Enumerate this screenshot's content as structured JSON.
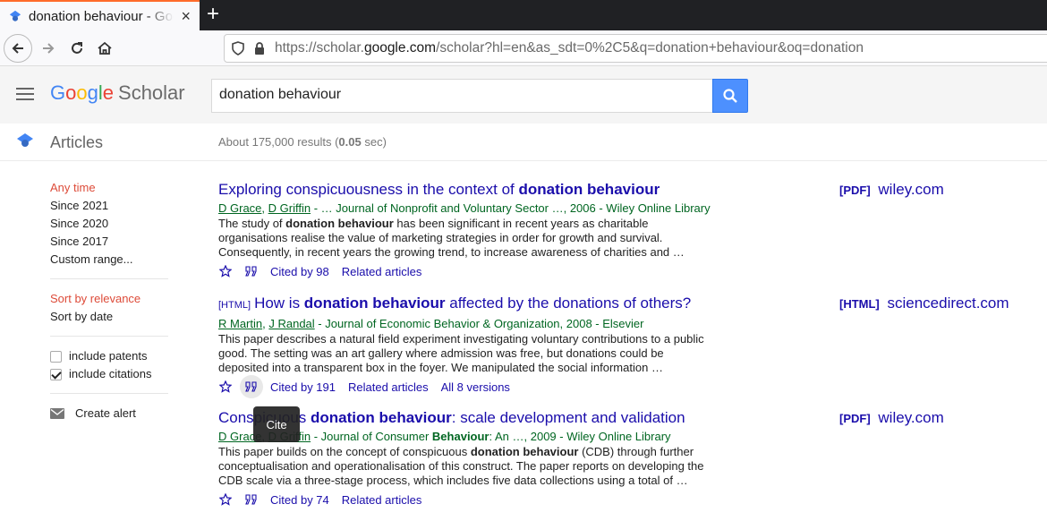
{
  "browser": {
    "tab_title": "donation behaviour - Google Scholar",
    "tab_close": "×",
    "new_tab": "+",
    "url_prefix": "https://scholar.",
    "url_domain": "google.com",
    "url_suffix": "/scholar?hl=en&as_sdt=0%2C5&q=donation+behaviour&oq=donation"
  },
  "logo": {
    "google": [
      "G",
      "o",
      "o",
      "g",
      "l",
      "e"
    ],
    "google_colors": [
      "#4285f4",
      "#ea4335",
      "#fbbc05",
      "#4285f4",
      "#34a853",
      "#ea4335"
    ],
    "scholar": "Scholar"
  },
  "search": {
    "value": "donation behaviour"
  },
  "subbar": {
    "section": "Articles",
    "results_prefix": "About 175,000 results (",
    "results_time": "0.05",
    "results_suffix": " sec)"
  },
  "sidebar": {
    "time": [
      "Any time",
      "Since 2021",
      "Since 2020",
      "Since 2017",
      "Custom range..."
    ],
    "sort": [
      "Sort by relevance",
      "Sort by date"
    ],
    "include_patents": "include patents",
    "include_citations": "include citations",
    "create_alert": "Create alert"
  },
  "results": [
    {
      "title_pre": "Exploring conspicuousness in the context of ",
      "title_bold": "donation behaviour",
      "title_post": "",
      "authors": [
        "D Grace",
        "D Griffin"
      ],
      "authors_sep": ", ",
      "source": " - … Journal of Nonprofit and Voluntary Sector …, 2006 - Wiley Online Library",
      "snippet_parts": [
        "The study of ",
        "donation behaviour",
        " has been significant in recent years as charitable organisations realise the value of marketing strategies in order for growth and survival. Consequently, in recent years the growing trend, to increase awareness of charities and …"
      ],
      "cited_by": "Cited by 98",
      "related": "Related articles",
      "side_tag": "[PDF]",
      "side_domain": "wiley.com"
    },
    {
      "tag": "[HTML]",
      "title_pre": "How is ",
      "title_bold": "donation behaviour",
      "title_post": " affected by the donations of others?",
      "authors": [
        "R Martin",
        "J Randal"
      ],
      "authors_sep": ", ",
      "source": " - Journal of Economic Behavior & Organization, 2008 - Elsevier",
      "snippet": "This paper describes a natural field experiment investigating voluntary contributions to a public good. The setting was an art gallery where admission was free, but donations could be deposited into a transparent box in the foyer. We manipulated the social information …",
      "cited_by": "Cited by 191",
      "related": "Related articles",
      "versions": "All 8 versions",
      "side_tag": "[HTML]",
      "side_domain": "sciencedirect.com"
    },
    {
      "title_pre": "Conspicuous ",
      "title_bold": "donation behaviour",
      "title_post": ": scale development and validation",
      "authors": [
        "D Grace",
        "D Griffin"
      ],
      "authors_sep": ", ",
      "source_pre": " - Journal of Consumer ",
      "source_bold": "Behaviour",
      "source_post": ": An …, 2009 - Wiley Online Library",
      "snippet_parts": [
        "This paper builds on the concept of conspicuous ",
        "donation behaviour",
        " (CDB) through further conceptualisation and operationalisation of this construct. The paper reports on developing the CDB scale via a three-stage process, which includes five data collections using a total of …"
      ],
      "cited_by": "Cited by 74",
      "related": "Related articles",
      "side_tag": "[PDF]",
      "side_domain": "wiley.com"
    }
  ],
  "tooltip": "Cite",
  "colors": {
    "accent": "#dd4b39",
    "link": "#1a0dab",
    "green": "#006621",
    "search_button": "#4d90fe"
  }
}
